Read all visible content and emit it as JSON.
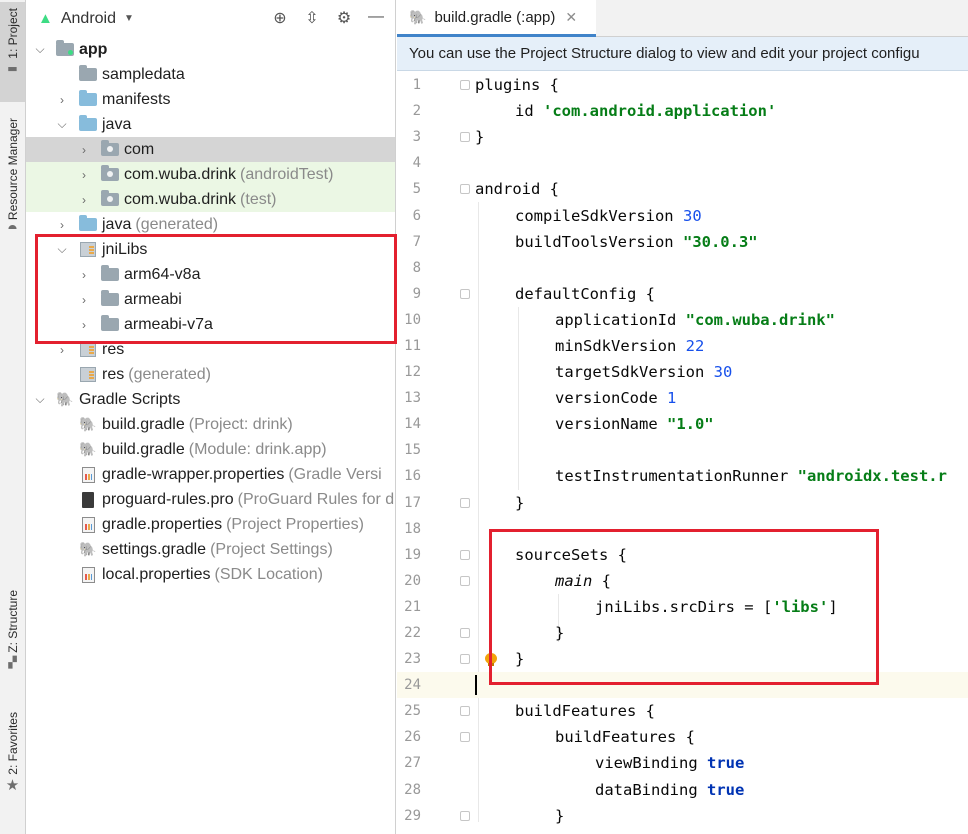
{
  "left_strip": {
    "project_tab": "1: Project",
    "resource_tab": "Resource Manager",
    "structure_tab": "Z: Structure",
    "favorites_tab": "2: Favorites"
  },
  "project_panel": {
    "view_selector": "Android",
    "tree": [
      {
        "label": "app",
        "bold": true
      },
      {
        "label": "sampledata"
      },
      {
        "label": "manifests"
      },
      {
        "label": "java"
      },
      {
        "label": "com"
      },
      {
        "label": "com.wuba.drink",
        "suffix": "(androidTest)"
      },
      {
        "label": "com.wuba.drink",
        "suffix": "(test)"
      },
      {
        "label": "java",
        "suffix": "(generated)"
      },
      {
        "label": "jniLibs"
      },
      {
        "label": "arm64-v8a"
      },
      {
        "label": "armeabi"
      },
      {
        "label": "armeabi-v7a"
      },
      {
        "label": "res"
      },
      {
        "label": "res",
        "suffix": "(generated)"
      },
      {
        "label": "Gradle Scripts"
      },
      {
        "label": "build.gradle",
        "suffix": "(Project: drink)"
      },
      {
        "label": "build.gradle",
        "suffix": "(Module: drink.app)"
      },
      {
        "label": "gradle-wrapper.properties",
        "suffix": "(Gradle Versi"
      },
      {
        "label": "proguard-rules.pro",
        "suffix": "(ProGuard Rules for d"
      },
      {
        "label": "gradle.properties",
        "suffix": "(Project Properties)"
      },
      {
        "label": "settings.gradle",
        "suffix": "(Project Settings)"
      },
      {
        "label": "local.properties",
        "suffix": "(SDK Location)"
      }
    ]
  },
  "editor": {
    "tab_label": "build.gradle (:app)",
    "banner": "You can use the Project Structure dialog to view and edit your project configu",
    "line_numbers": [
      "1",
      "2",
      "3",
      "4",
      "5",
      "6",
      "7",
      "8",
      "9",
      "10",
      "11",
      "12",
      "13",
      "14",
      "15",
      "16",
      "17",
      "18",
      "19",
      "20",
      "21",
      "22",
      "23",
      "24",
      "25",
      "26",
      "27",
      "28",
      "29"
    ],
    "code": {
      "l1": "plugins {",
      "l2_id": "id ",
      "l2_str": "'com.android.application'",
      "l3": "}",
      "l5": "android {",
      "l6_key": "compileSdkVersion ",
      "l6_val": "30",
      "l7_key": "buildToolsVersion ",
      "l7_val": "\"30.0.3\"",
      "l9": "defaultConfig {",
      "l10_key": "applicationId ",
      "l10_val": "\"com.wuba.drink\"",
      "l11_key": "minSdkVersion ",
      "l11_val": "22",
      "l12_key": "targetSdkVersion ",
      "l12_val": "30",
      "l13_key": "versionCode ",
      "l13_val": "1",
      "l14_key": "versionName ",
      "l14_val": "\"1.0\"",
      "l16_key": "testInstrumentationRunner ",
      "l16_val": "\"androidx.test.r",
      "l17": "}",
      "l19": "sourceSets {",
      "l20_main": "main",
      "l20_brace": " {",
      "l21_key": "jniLibs.srcDirs = [",
      "l21_val": "'libs'",
      "l21_end": "]",
      "l22": "}",
      "l23": "}",
      "l25": "buildFeatures {",
      "l26": "buildFeatures {",
      "l27_key": "viewBinding ",
      "l27_val": "true",
      "l28_key": "dataBinding ",
      "l28_val": "true",
      "l29": "}"
    }
  }
}
